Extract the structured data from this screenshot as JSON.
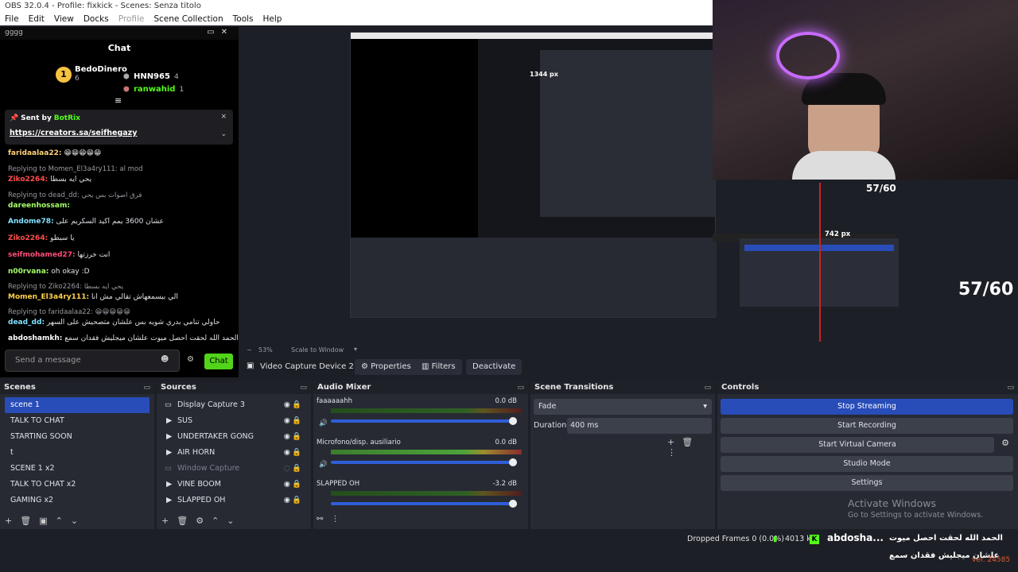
{
  "window": {
    "title": "OBS 32.0.4 - Profile: fixkick - Scenes: Senza titolo"
  },
  "menu": [
    "File",
    "Edit",
    "View",
    "Docks",
    "Profile",
    "Scene Collection",
    "Tools",
    "Help"
  ],
  "chat_dock": {
    "dock_title": "gggg",
    "title": "Chat",
    "leaderboard": [
      {
        "rank_name": "BedoDinero",
        "count": "6"
      },
      {
        "rank_name": "HNN965",
        "count": "4"
      },
      {
        "rank_name": "ranwahid",
        "count": "1"
      }
    ],
    "pinned": {
      "sender_label": "Sent by",
      "sender": "BotRix",
      "link": "https://creators.sa/seifhegazy"
    },
    "messages": [
      {
        "user": "faridaalaa22:",
        "text": "😁😁😁😁😁"
      },
      {
        "reply": "Replying to Momen_El3a4ry111: al mod"
      },
      {
        "user": "Ziko2264:",
        "text": "يحي ايه بسطا"
      },
      {
        "reply": "Replying to dead_dd: فرق اصوات بس يحي"
      },
      {
        "user": "dareenhossam:",
        "text": ""
      },
      {
        "user": "Andome78:",
        "text": "عشان 3600 يمم اكيد السكريم على"
      },
      {
        "user": "Ziko2264:",
        "text": "يا سبطو"
      },
      {
        "user": "seifmohamed27:",
        "text": "انت خرزتها"
      },
      {
        "user": "n00rvana:",
        "text": "oh okay :D"
      },
      {
        "reply": "Replying to Ziko2264: يحي ايه بسطا"
      },
      {
        "user": "Momen_El3a4ry111:",
        "text": "الي بيسمعهاش تقالي مش انا"
      },
      {
        "reply": "Replying to faridaalaa22: 😁😁😁😁😁"
      },
      {
        "user": "dead_dd:",
        "text": "حاولي تنامي بدري شويه بس علشان متصحيش على السهر"
      },
      {
        "user": "abdoshamkh:",
        "text": "الحمد الله لحقت احصل ميوت علشان ميجليش فقدان سمع"
      }
    ],
    "input_placeholder": "Send a message",
    "chat_button": "Chat"
  },
  "preview": {
    "zoom": "53%",
    "scale_mode": "Scale to Window",
    "overlay_px_top": "1344 px",
    "overlay_px_mid": "742 px",
    "fps_small": "57/60",
    "fps_large": "57/60"
  },
  "source_toolbar": {
    "source_name": "Video Capture Device 2",
    "properties": "Properties",
    "filters": "Filters",
    "deactivate": "Deactivate"
  },
  "scenes": {
    "title": "Scenes",
    "items": [
      "scene 1",
      "TALK TO CHAT",
      "STARTING SOON",
      "t",
      "SCENE 1 x2",
      "TALK TO CHAT x2",
      "GAMING x2"
    ],
    "selected": 0
  },
  "sources": {
    "title": "Sources",
    "items": [
      "Display Capture 3",
      "SUS",
      "UNDERTAKER GONG",
      "AIR HORN",
      "Window Capture",
      "VINE BOOM",
      "SLAPPED OH"
    ]
  },
  "mixer": {
    "title": "Audio Mixer",
    "channels": [
      {
        "name": "faaaaaahh",
        "db": "0.0 dB",
        "level": 0.0
      },
      {
        "name": "Microfono/disp. ausiliario",
        "db": "0.0 dB",
        "level": 0.72
      },
      {
        "name": "SLAPPED OH",
        "db": "-3.2 dB",
        "level": 0.0
      }
    ],
    "scale": [
      "-60",
      "-55",
      "-50",
      "-45",
      "-40",
      "-35",
      "-30",
      "-25",
      "-20",
      "-15",
      "-10",
      "-5",
      "0"
    ]
  },
  "transitions": {
    "title": "Scene Transitions",
    "selected": "Fade",
    "duration_label": "Duration",
    "duration": "400 ms"
  },
  "controls": {
    "title": "Controls",
    "stop_streaming": "Stop Streaming",
    "start_recording": "Start Recording",
    "start_virtual_camera": "Start Virtual Camera",
    "studio_mode": "Studio Mode",
    "settings": "Settings"
  },
  "watermark": {
    "line1": "Activate Windows",
    "line2": "Go to Settings to activate Windows."
  },
  "status": {
    "dropped_frames": "Dropped Frames 0 (0.0%)",
    "bitrate": "4013 kb",
    "overlay_user": "abdosha...",
    "overlay_ar1": "الحمد الله لحقت احصل ميوت",
    "overlay_ar2": "علشان ميجليش فقدان سمع",
    "version": "ver. 24585"
  },
  "colors": {
    "accent": "#284cb8",
    "chat_green": "#52d41a",
    "kick_green": "#53fc18"
  }
}
